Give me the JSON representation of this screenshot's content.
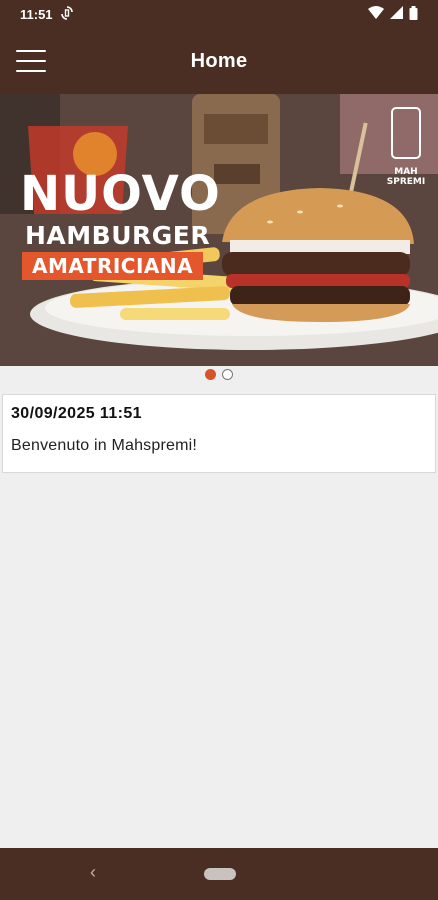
{
  "status_bar": {
    "time": "11:51",
    "notification_icon": "sync-icon",
    "icons": [
      "wifi-icon",
      "signal-icon",
      "battery-icon"
    ]
  },
  "app_bar": {
    "title": "Home",
    "menu_icon": "hamburger-menu-icon"
  },
  "carousel": {
    "banner": {
      "headline": "NUOVO",
      "subheadline": "HAMBURGER",
      "tag": "AMATRICIANA",
      "logo_text": "MAH SPREMI"
    },
    "pages": 2,
    "active_page": 1,
    "colors": {
      "active_dot": "#d9532a",
      "tag_bg": "#e4562b"
    }
  },
  "messages": [
    {
      "date": "30/09/2025 11:51",
      "text": "Benvenuto in Mahspremi!"
    }
  ],
  "nav_bar": {
    "back_icon": "back-icon",
    "home_icon": "home-pill-icon"
  },
  "colors": {
    "app_bar": "#4a2e23",
    "background": "#efefef"
  }
}
